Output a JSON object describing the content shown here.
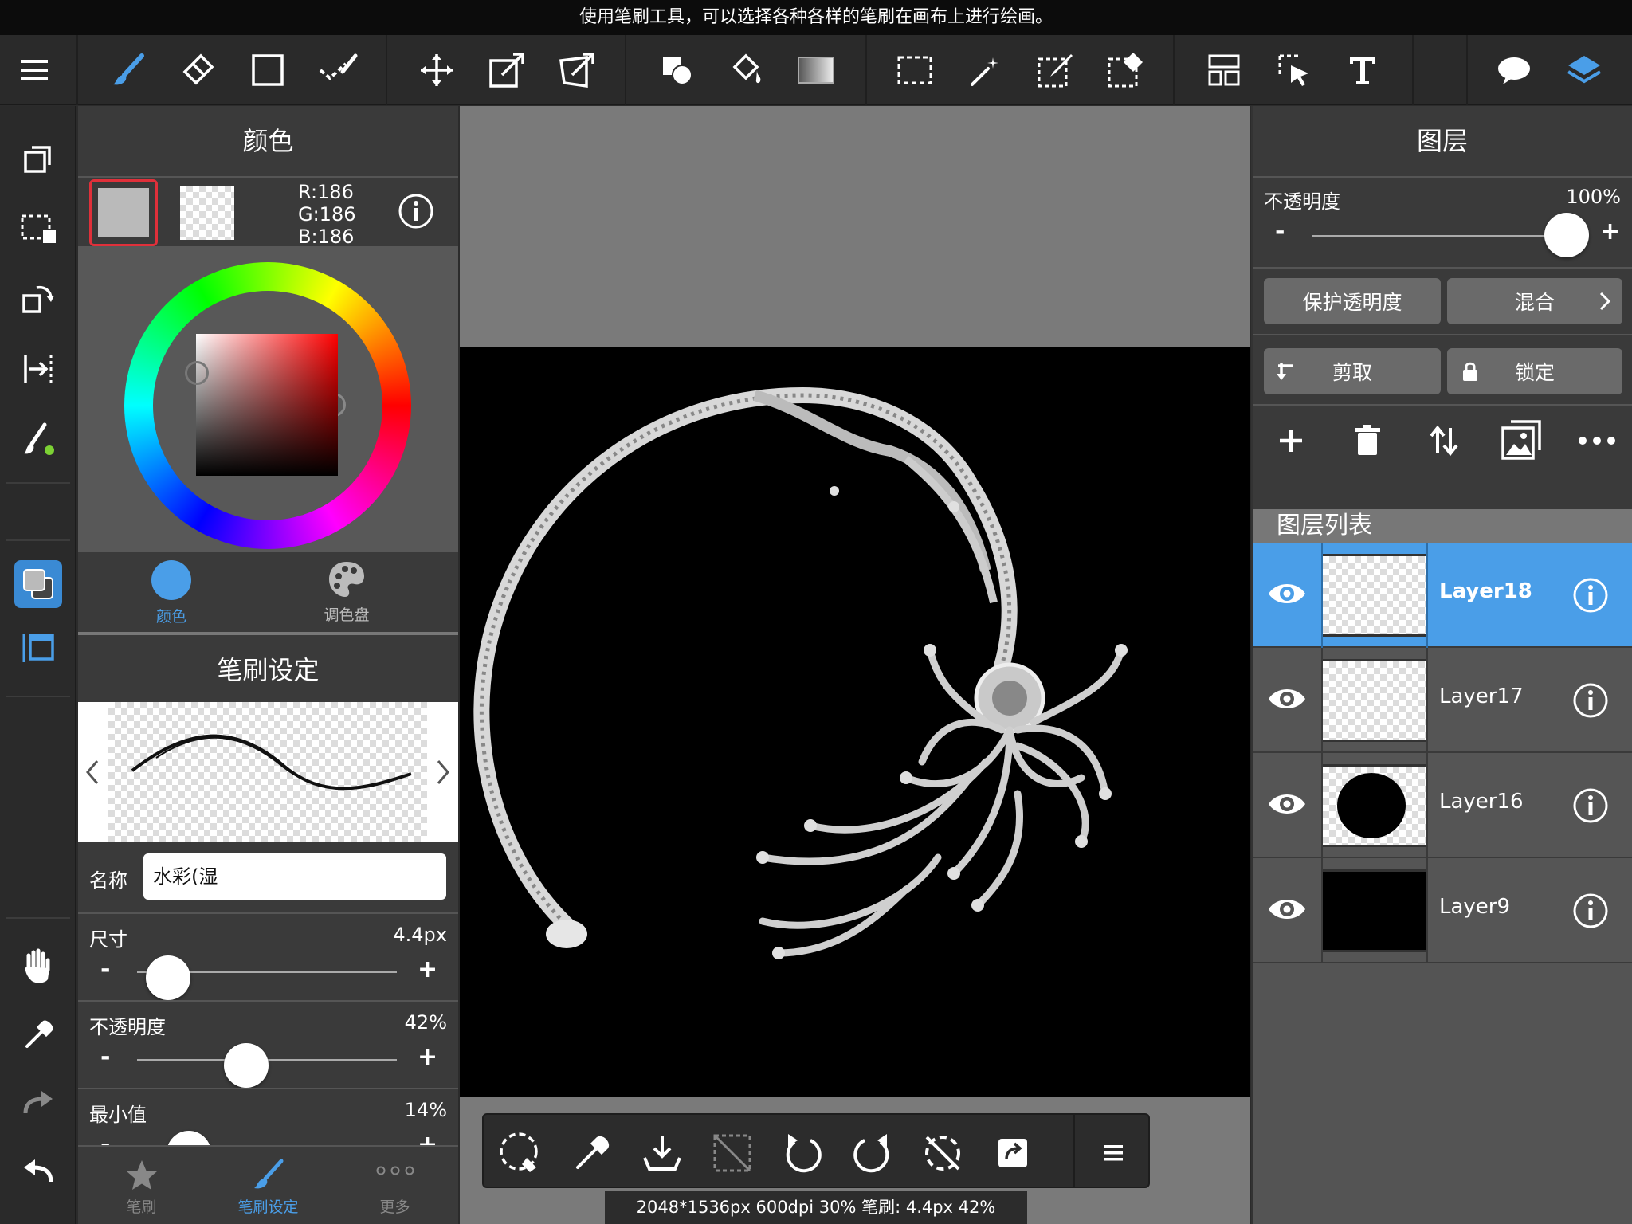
{
  "hint_bar": {
    "text": "使用笔刷工具，可以选择各种各样的笔刷在画布上进行绘画。"
  },
  "toolbar": {
    "icons": [
      "menu-icon",
      "brush-icon",
      "eraser-icon",
      "rectangle-shape-icon",
      "correction-icon",
      "move-icon",
      "transform-icon",
      "deform-icon",
      "fill-shape-icon",
      "bucket-icon",
      "gradient-icon",
      "rect-select-icon",
      "magic-wand-icon",
      "select-pen-icon",
      "select-eraser-icon",
      "frame-divider-icon",
      "operation-icon",
      "text-icon",
      "comment-icon",
      "layers-icon"
    ],
    "active": "brush-icon",
    "accent": "#4a9ee8"
  },
  "left_tools": {
    "icons": [
      "copy-layer-icon",
      "select-icon",
      "rotate-icon",
      "flip-icon",
      "brush-settings-icon",
      "color-icon",
      "frame-icon",
      "hand-icon",
      "eyedropper-icon",
      "redo-icon",
      "undo-icon"
    ]
  },
  "color_panel": {
    "title": "颜色",
    "primary_color": "#bababa",
    "r": "R:186",
    "g": "G:186",
    "b": "B:186",
    "tabs": [
      {
        "label": "颜色",
        "active": true
      },
      {
        "label": "调色盘",
        "active": false
      }
    ]
  },
  "brush_panel": {
    "title": "笔刷设定",
    "name_label": "名称",
    "name_value": "水彩(湿",
    "size": {
      "label": "尺寸",
      "value": "4.4px",
      "fraction": 0.12
    },
    "opacity": {
      "label": "不透明度",
      "value": "42%",
      "fraction": 0.42
    },
    "min": {
      "label": "最小值",
      "value": "14%",
      "fraction": 0.2
    },
    "minus": "-",
    "plus": "+",
    "bottom_tabs": [
      {
        "label": "笔刷",
        "active": false
      },
      {
        "label": "笔刷设定",
        "active": true
      },
      {
        "label": "更多",
        "active": false
      }
    ]
  },
  "canvas": {
    "status": "2048*1536px 600dpi 30% 笔刷: 4.4px 42%",
    "quick_tools": [
      "lasso-fill-icon",
      "eyedropper-icon",
      "save-icon",
      "deselect-icon",
      "undo-icon",
      "redo-icon",
      "clear-icon",
      "share-icon",
      "menu-icon"
    ]
  },
  "layer_panel": {
    "title": "图层",
    "opacity_label": "不透明度",
    "opacity_value": "100%",
    "opacity_fraction": 1.0,
    "minus": "-",
    "plus": "+",
    "protect_label": "保护透明度",
    "blend_label": "混合",
    "clip_label": "剪取",
    "lock_label": "锁定",
    "list_title": "图层列表",
    "layers": [
      {
        "name": "Layer18",
        "selected": true
      },
      {
        "name": "Layer17",
        "selected": false
      },
      {
        "name": "Layer16",
        "selected": false
      },
      {
        "name": "Layer9",
        "selected": false
      }
    ]
  }
}
